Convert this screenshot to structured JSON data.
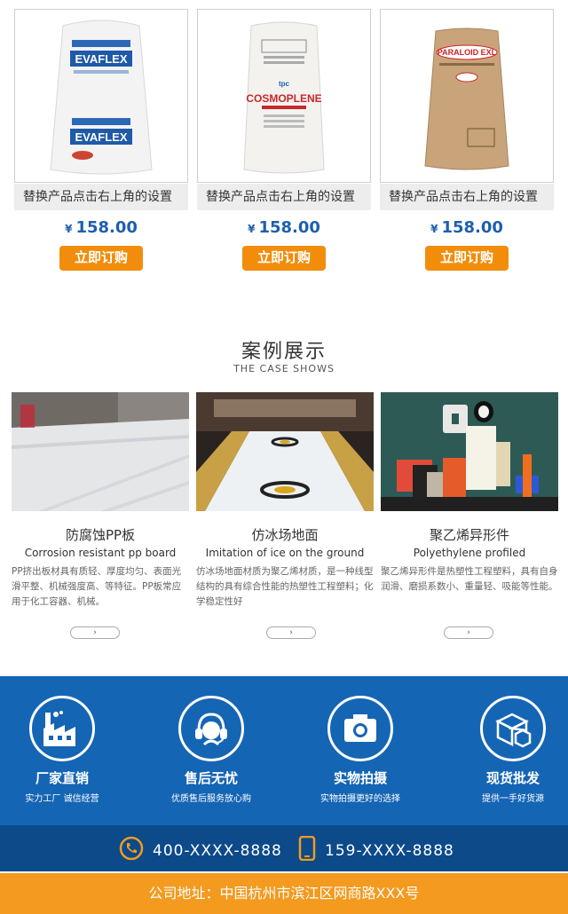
{
  "products": [
    {
      "name": "替换产品点击右上角的设置",
      "currency": "¥",
      "price": "158.00",
      "order_label": "立即订购",
      "brand": "EVAFLEX"
    },
    {
      "name": "替换产品点击右上角的设置",
      "currency": "¥",
      "price": "158.00",
      "order_label": "立即订购",
      "brand": "COSMOPLENE"
    },
    {
      "name": "替换产品点击右上角的设置",
      "currency": "¥",
      "price": "158.00",
      "order_label": "立即订购",
      "brand": "PARALOID EXL"
    }
  ],
  "cases_section": {
    "title": "案例展示",
    "subtitle": "THE CASE SHOWS",
    "arrow": "›"
  },
  "cases": [
    {
      "title": "防腐蚀PP板",
      "en": "Corrosion resistant pp board",
      "desc": "PP挤出板材具有质轻、厚度均匀、表面光滑平整、机械强度高、等特征。PP板常应用于化工容器、机械。"
    },
    {
      "title": "仿冰场地面",
      "en": "Imitation of ice on the ground",
      "desc": "仿冰场地面材质为聚乙烯材质，是一种线型结构的具有综合性能的热塑性工程塑料；化学稳定性好"
    },
    {
      "title": "聚乙烯异形件",
      "en": "Polyethylene profiled",
      "desc": "聚乙烯异形件是热塑性工程塑料，具有自身润滑、磨损系数小、重量轻、吸能等性能。"
    }
  ],
  "features": [
    {
      "title": "厂家直销",
      "sub": "实力工厂  诚信经营",
      "icon": "factory-icon"
    },
    {
      "title": "售后无忧",
      "sub": "优质售后服务放心购",
      "icon": "headset-icon"
    },
    {
      "title": "实物拍摄",
      "sub": "实物拍摄更好的选择",
      "icon": "camera-icon"
    },
    {
      "title": "现货批发",
      "sub": "提供一手好货源",
      "icon": "boxes-icon"
    }
  ],
  "contact": {
    "phone": "400-XXXX-8888",
    "mobile": "159-XXXX-8888"
  },
  "address": "公司地址：中国杭州市滨江区网商路XXX号",
  "colors": {
    "accent": "#f28d0c",
    "blue": "#1565b5",
    "dark_blue": "#0c4a8a",
    "price": "#1e5faf"
  }
}
